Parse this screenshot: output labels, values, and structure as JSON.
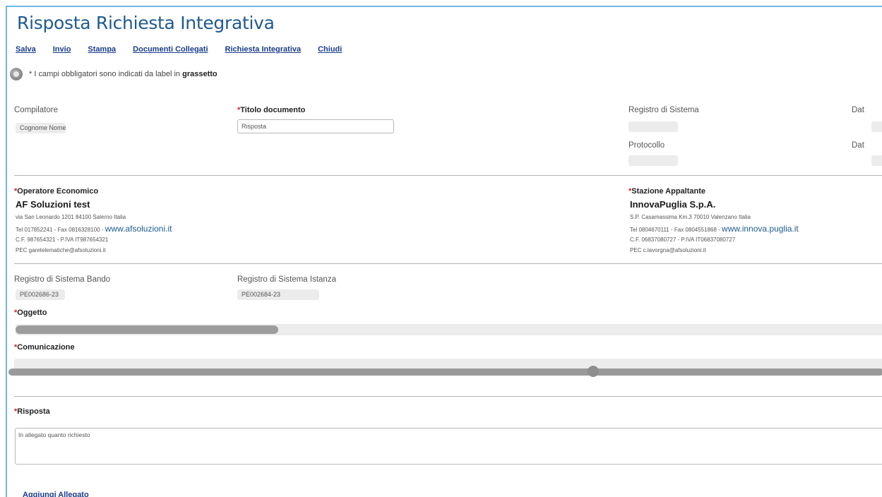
{
  "page": {
    "title": "Risposta Richiesta Integrativa"
  },
  "toolbar": {
    "items": [
      "Salva",
      "Invio",
      "Stampa",
      "Documenti Collegati",
      "Richiesta Integrativa",
      "Chiudi"
    ]
  },
  "info": {
    "text_prefix": "* I campi obbligatori sono indicati da label in ",
    "text_bold": "grassetto"
  },
  "header_fields": {
    "compilatore_label": "Compilatore",
    "compilatore_value": "Cognome Nome",
    "titolo_label": "Titolo documento",
    "titolo_value": "Risposta",
    "registro_label": "Registro di Sistema",
    "data_label_1": "Dat",
    "protocollo_label": "Protocollo",
    "data_label_2": "Dat"
  },
  "operatore": {
    "label": "Operatore Economico",
    "name": "AF Soluzioni test",
    "address": "via San Leonardo 1201 84100 Salerno Italia",
    "contacts": "Tel 017852241 - Fax 0816328100 - ",
    "website": "www.afsoluzioni.it",
    "tax": "C.F. 987654321 - P.IVA IT987654321",
    "pec": "PEC garetelematiche@afsoluzioni.it"
  },
  "stazione": {
    "label": "Stazione Appaltante",
    "name": "InnovaPuglia S.p.A.",
    "address": "S.P. Casamassima Km.3 70010 Valenzano Italia",
    "contacts": "Tel 0804670111 - Fax 0804551868 - ",
    "website": "www.innova.puglia.it",
    "tax": "C.F. 06837080727 - P.IVA IT06837080727",
    "pec": "PEC c.lavorgna@afsoluzioni.it"
  },
  "registri": {
    "bando_label": "Registro di Sistema Bando",
    "bando_value": "PE002686-23",
    "istanza_label": "Registro di Sistema Istanza",
    "istanza_value": "PE002684-23"
  },
  "oggetto": {
    "label": "Oggetto"
  },
  "comunicazione": {
    "label": "Comunicazione"
  },
  "risposta": {
    "label": "Risposta",
    "value": "In allegato quanto richiesto"
  },
  "allegato": {
    "link": "Aggiungi Allegato"
  },
  "colors": {
    "title": "#1f5a8f",
    "link": "#1a3c8b",
    "required": "#d21f1f",
    "frame": "#6fb7e6"
  }
}
